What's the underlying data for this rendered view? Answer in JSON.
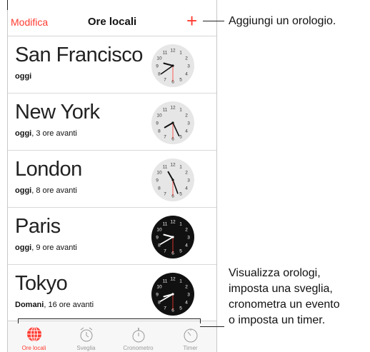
{
  "nav": {
    "edit_label": "Modifica",
    "title": "Ore locali",
    "add_symbol": "+"
  },
  "cities": [
    {
      "name": "San Francisco",
      "day": "oggi",
      "offset": "",
      "dark": false
    },
    {
      "name": "New York",
      "day": "oggi",
      "offset": ", 3 ore avanti",
      "dark": false
    },
    {
      "name": "London",
      "day": "oggi",
      "offset": ", 8 ore avanti",
      "dark": false
    },
    {
      "name": "Paris",
      "day": "oggi",
      "offset": ", 9 ore avanti",
      "dark": true
    },
    {
      "name": "Tokyo",
      "day": "Domani",
      "offset": ", 16 ore avanti",
      "dark": true
    }
  ],
  "tabs": [
    {
      "label": "Ore locali",
      "icon": "globe-icon",
      "active": true
    },
    {
      "label": "Sveglia",
      "icon": "alarm-clock-icon",
      "active": false
    },
    {
      "label": "Cronometro",
      "icon": "stopwatch-icon",
      "active": false
    },
    {
      "label": "Timer",
      "icon": "timer-icon",
      "active": false
    }
  ],
  "callouts": {
    "add_clock": "Aggiungi un orologio.",
    "bottom": [
      "Visualizza orologi,",
      "imposta una sveglia,",
      "cronometra un evento",
      "o imposta un timer."
    ]
  },
  "colors": {
    "accent": "#ff3b30",
    "clock_light": "#e6e6e6",
    "clock_dark": "#111111"
  }
}
